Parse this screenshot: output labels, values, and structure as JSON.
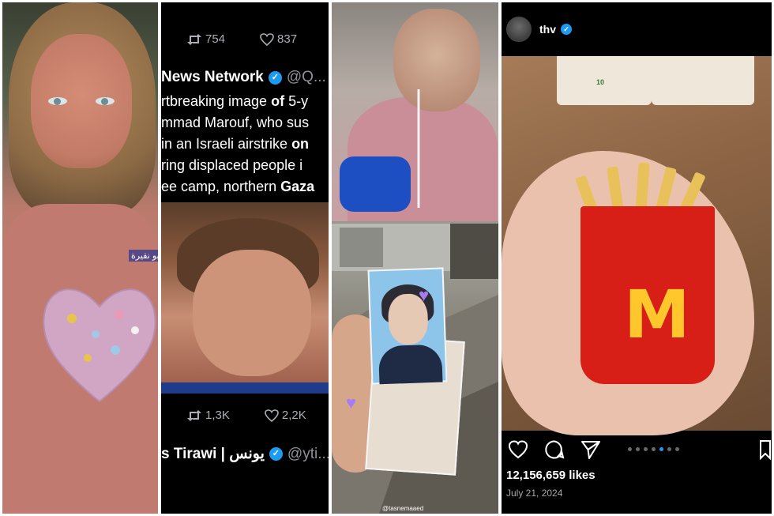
{
  "panel1": {
    "name_tag": "أبو نقيرة"
  },
  "panel2": {
    "top_stats": {
      "retweets": "754",
      "likes": "837"
    },
    "tweet1": {
      "author": "News Network",
      "handle": "@Q...",
      "lines": [
        {
          "parts": [
            "rtbreaking image ",
            "of",
            " 5-y"
          ]
        },
        {
          "parts": [
            "mmad Marouf, who sus"
          ]
        },
        {
          "parts": [
            "in an Israeli airstrike ",
            "on"
          ]
        },
        {
          "parts": [
            "ring displaced people i"
          ]
        },
        {
          "parts": [
            "ee camp, northern ",
            "Gaza"
          ]
        }
      ]
    },
    "bottom_stats": {
      "retweets": "1,3K",
      "likes": "2,2K"
    },
    "tweet2": {
      "author": "s Tirawi | يونس",
      "handle": "@yti..."
    }
  },
  "panel3": {
    "watermark": "@tasnemaaed"
  },
  "panel4": {
    "username": "thv",
    "likes": "12,156,659 likes",
    "date": "July 21, 2024",
    "box_number": "10",
    "logo": "M"
  },
  "colors": {
    "verified": "#1d9bf0",
    "mcd_red": "#d71f18",
    "mcd_yellow": "#ffc72c",
    "heart_purple": "#a57cf2"
  }
}
